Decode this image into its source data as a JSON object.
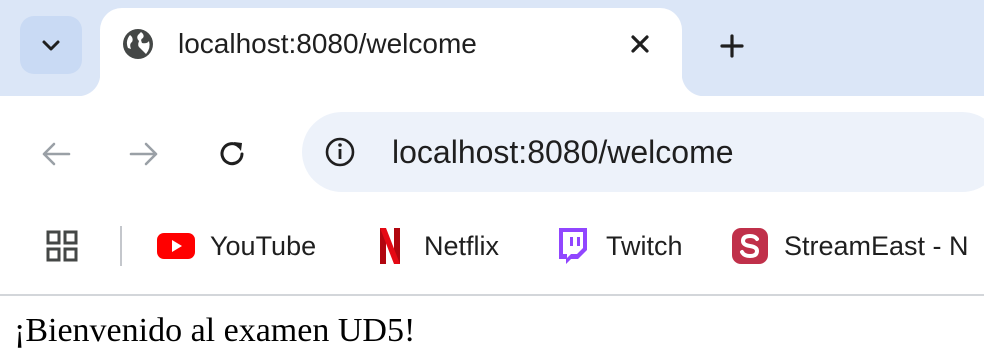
{
  "tab": {
    "title": "localhost:8080/welcome",
    "favicon": "globe-icon",
    "close_icon": "close-icon"
  },
  "tabstrip": {
    "search_icon": "chevron-down-icon",
    "new_tab_icon": "plus-icon"
  },
  "toolbar": {
    "back_icon": "arrow-left-icon",
    "forward_icon": "arrow-right-icon",
    "reload_icon": "reload-icon",
    "site_info_icon": "info-icon",
    "url": "localhost:8080/welcome"
  },
  "bookmarks": {
    "apps_icon": "grid-icon",
    "items": [
      {
        "label": "YouTube",
        "icon": "youtube-icon",
        "color": "#ff0000"
      },
      {
        "label": "Netflix",
        "icon": "netflix-icon",
        "color": "#e50914"
      },
      {
        "label": "Twitch",
        "icon": "twitch-icon",
        "color": "#9146ff"
      },
      {
        "label": "StreamEast - N",
        "icon": "streameast-icon",
        "color": "#c0304a"
      }
    ]
  },
  "page": {
    "heading": "¡Bienvenido al examen UD5!"
  },
  "colors": {
    "tabstrip_bg": "#dbe6f7",
    "omnibox_bg": "#edf2fa",
    "text": "#1f1f1f"
  }
}
